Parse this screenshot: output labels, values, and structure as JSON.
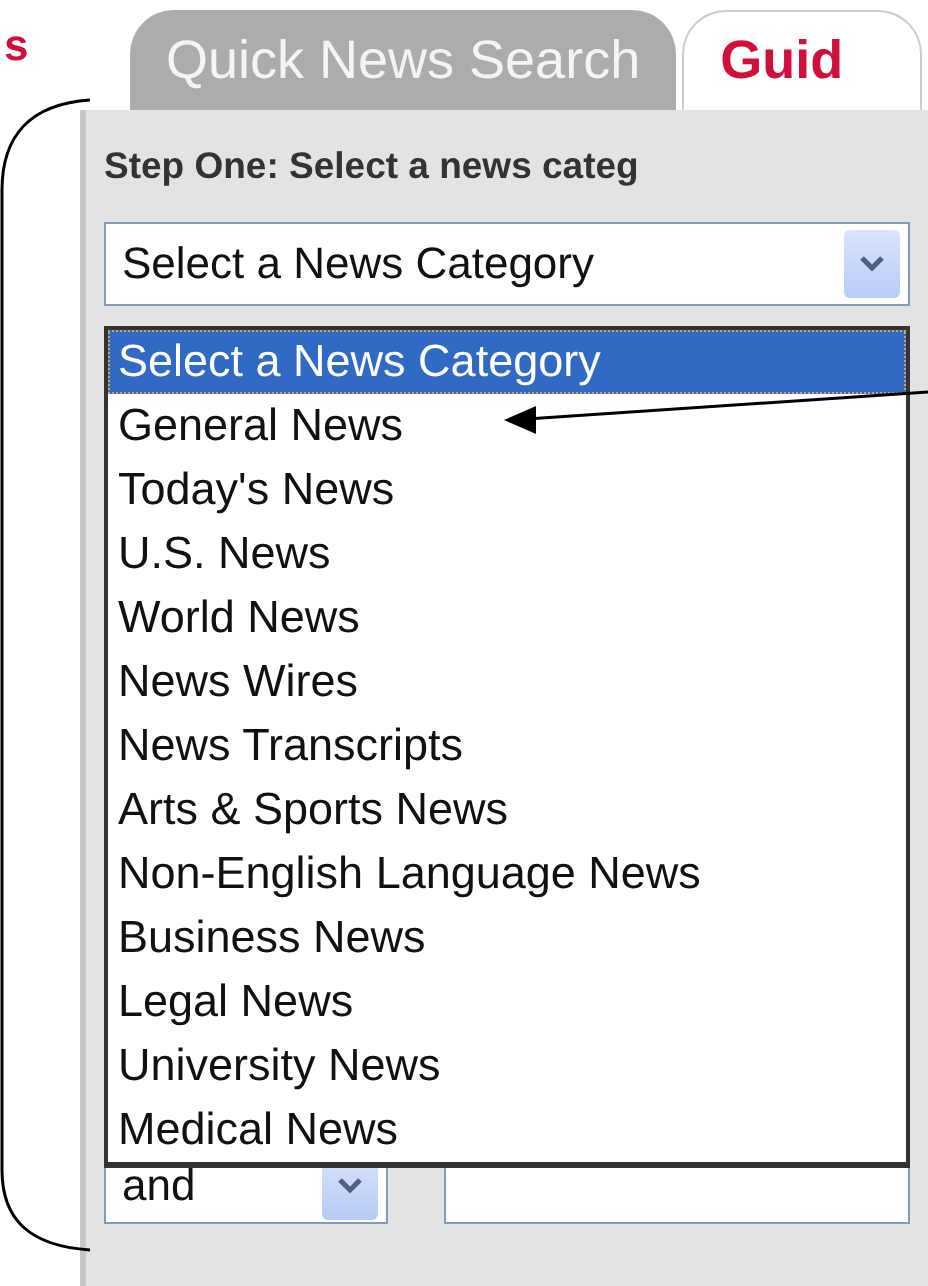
{
  "corner_text": "s",
  "tabs": [
    {
      "label": "Quick News Search",
      "selected": false
    },
    {
      "label": "Guid",
      "selected": true
    }
  ],
  "step_heading": "Step One: Select a news categ",
  "category_select": {
    "value": "Select a News Category",
    "expanded": true
  },
  "category_options": [
    {
      "label": "Select a News Category",
      "selected": true
    },
    {
      "label": "General News",
      "selected": false
    },
    {
      "label": "Today's News",
      "selected": false
    },
    {
      "label": "U.S. News",
      "selected": false
    },
    {
      "label": "World News",
      "selected": false
    },
    {
      "label": "News Wires",
      "selected": false
    },
    {
      "label": "News Transcripts",
      "selected": false
    },
    {
      "label": "Arts & Sports News",
      "selected": false
    },
    {
      "label": "Non-English Language News",
      "selected": false
    },
    {
      "label": "Business News",
      "selected": false
    },
    {
      "label": "Legal News",
      "selected": false
    },
    {
      "label": "University News",
      "selected": false
    },
    {
      "label": "Medical News",
      "selected": false
    }
  ],
  "operator_select": {
    "value": "and"
  }
}
